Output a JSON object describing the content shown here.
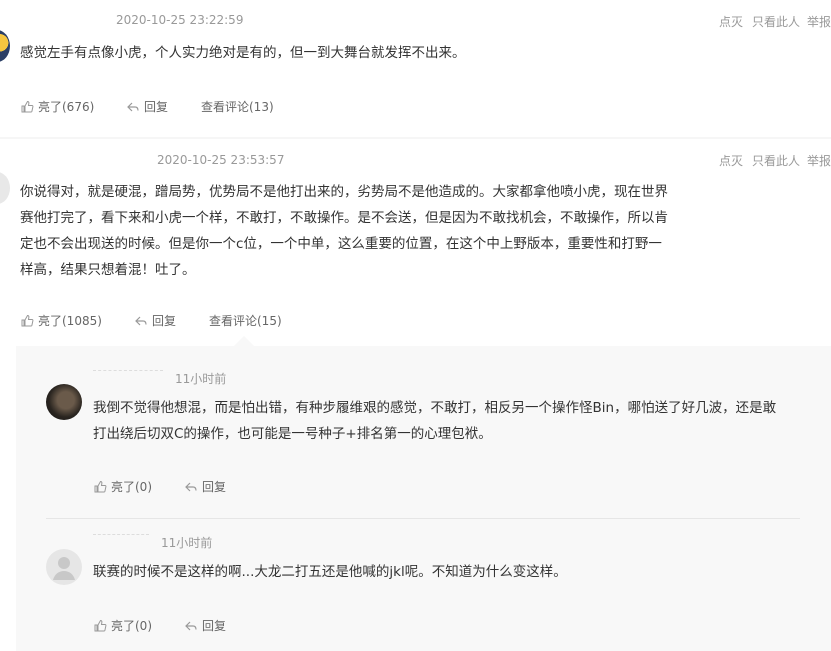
{
  "comments": [
    {
      "timestamp": "2020-10-25 23:22:59",
      "text": "感觉左手有点像小虎，个人实力绝对是有的，但一到大舞台就发挥不出来。",
      "like_label": "亮了(676)",
      "reply_label": "回复",
      "view_comments_label": "查看评论(13)",
      "menu": {
        "dislike": "点灭",
        "only_this": "只看此人",
        "report": "举报"
      }
    },
    {
      "timestamp": "2020-10-25 23:53:57",
      "text_lines": [
        "你说得对，就是硬混，蹭局势，优势局不是他打出来的，劣势局不是他造成的。大家都拿他喷小虎，现在世界",
        "赛他打完了，看下来和小虎一个样，不敢打，不敢操作。是不会送，但是因为不敢找机会，不敢操作，所以肯",
        "定也不会出现送的时候。但是你一个c位，一个中单，这么重要的位置，在这个中上野版本，重要性和打野一",
        "样高，结果只想着混！吐了。"
      ],
      "like_label": "亮了(1085)",
      "reply_label": "回复",
      "view_comments_label": "查看评论(15)",
      "menu": {
        "dislike": "点灭",
        "only_this": "只看此人",
        "report": "举报"
      }
    }
  ],
  "replies": [
    {
      "timestamp": "11小时前",
      "text_lines": [
        "我倒不觉得他想混，而是怕出错，有种步履维艰的感觉，不敢打，相反另一个操作怪Bin，哪怕送了好几波，还是敢",
        "打出绕后切双C的操作，也可能是一号种子+排名第一的心理包袱。"
      ],
      "like_label": "亮了(0)",
      "reply_label": "回复"
    },
    {
      "timestamp": "11小时前",
      "text": "联赛的时候不是这样的啊...大龙二打五还是他喊的jkl呢。不知道为什么变这样。",
      "like_label": "亮了(0)",
      "reply_label": "回复"
    }
  ],
  "colors": {
    "background": "#f6f6f6",
    "card": "#ffffff",
    "muted": "#999999",
    "text": "#333333",
    "divider": "#e6e6e6"
  }
}
